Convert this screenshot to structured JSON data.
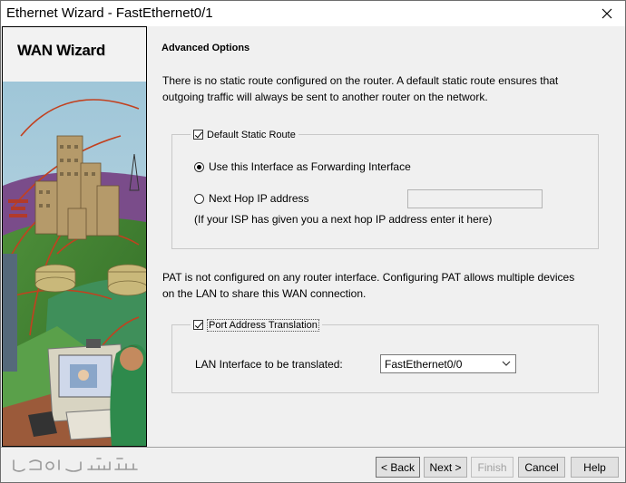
{
  "window": {
    "title": "Ethernet Wizard - FastEthernet0/1"
  },
  "side_panel": {
    "label": "WAN Wizard"
  },
  "content": {
    "section_title": "Advanced Options",
    "static_route_info": "There is no static route configured on the router. A default static route ensures that outgoing traffic will always be sent to another router on the network.",
    "default_route_group": {
      "label": "Default Static Route",
      "checked": true,
      "option_interface": "Use this Interface as Forwarding Interface",
      "option_next_hop": "Next Hop IP address",
      "selected_option": "interface",
      "next_hop_value": "",
      "hint": "(If your ISP has given you a next hop IP address enter it here)"
    },
    "pat_info": "PAT is not configured on any router interface. Configuring PAT allows multiple devices on the LAN to share this WAN connection.",
    "pat_group": {
      "label": "Port Address Translation",
      "checked": true,
      "lan_label": "LAN Interface to be translated:",
      "lan_value": "FastEthernet0/0"
    }
  },
  "buttons": {
    "back": "< Back",
    "next": "Next >",
    "finish": "Finish",
    "cancel": "Cancel",
    "help": "Help"
  },
  "colors": {
    "dialog_bg": "#f0f0f0",
    "disabled_text": "#a0a0a0"
  }
}
